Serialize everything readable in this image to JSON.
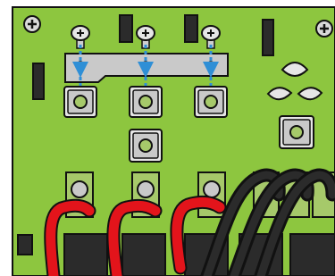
{
  "illustration": {
    "kind": "circuit-board-assembly-diagram",
    "colors": {
      "board_green": "#8dc63f",
      "board_dark_green": "#5e8f2a",
      "outline": "#111111",
      "metal_silver": "#c9c9c9",
      "metal_light": "#e6e6e6",
      "arrow_blue": "#2f8fd6",
      "wire_red": "#e3141b",
      "wire_black": "#111111",
      "component_dark": "#2b2b2b",
      "background": "#ffffff"
    },
    "icons": {
      "screw": "phillips-screw-icon",
      "arrow": "dashed-arrow-down-icon",
      "terminal": "square-terminal-pad-icon"
    },
    "counts": {
      "top_screws": 3,
      "busbar_targets": 3,
      "red_wires": 3,
      "black_wires": 3
    }
  }
}
